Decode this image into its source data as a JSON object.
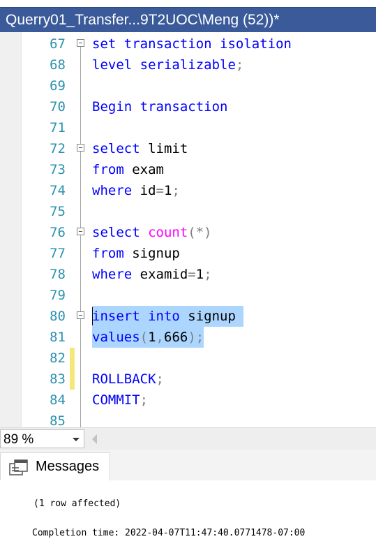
{
  "window": {
    "tab_title": "Querry01_Transfer...9T2UOC\\Meng (52))*"
  },
  "editor": {
    "lines": [
      {
        "n": "67",
        "code": "set transaction isolation"
      },
      {
        "n": "68",
        "code": "level serializable;"
      },
      {
        "n": "69",
        "code": ""
      },
      {
        "n": "70",
        "code": "Begin transaction"
      },
      {
        "n": "71",
        "code": ""
      },
      {
        "n": "72",
        "code": "select limit"
      },
      {
        "n": "73",
        "code": "from exam"
      },
      {
        "n": "74",
        "code": "where id=1;"
      },
      {
        "n": "75",
        "code": ""
      },
      {
        "n": "76",
        "code": "select count(*)"
      },
      {
        "n": "77",
        "code": "from signup"
      },
      {
        "n": "78",
        "code": "where examid=1;"
      },
      {
        "n": "79",
        "code": ""
      },
      {
        "n": "80",
        "code": "insert into signup"
      },
      {
        "n": "81",
        "code": "values(1,666);"
      },
      {
        "n": "82",
        "code": ""
      },
      {
        "n": "83",
        "code": "ROLLBACK;"
      },
      {
        "n": "84",
        "code": "COMMIT;"
      },
      {
        "n": "85",
        "code": ""
      }
    ],
    "colors": {
      "keyword": "#0000ff",
      "function": "#ff00ff",
      "operator": "#808080",
      "line_number": "#2b91af",
      "selection": "#add6ff",
      "change_marker": "#f6e77a"
    }
  },
  "zoom": {
    "value": "89 %"
  },
  "results": {
    "tab_label": "Messages",
    "tab_icon": "messages-icon",
    "line1": "(1 row affected)",
    "line2": "Completion time: 2022-04-07T11:47:40.0771478-07:00"
  }
}
